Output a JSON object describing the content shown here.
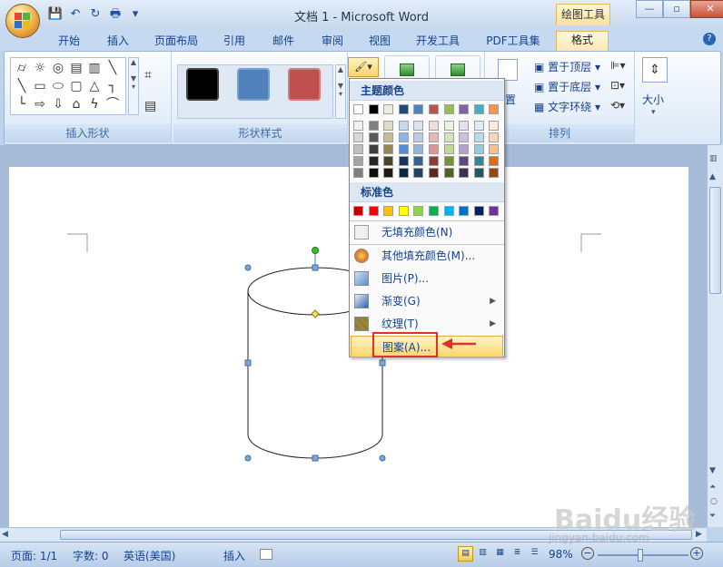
{
  "window": {
    "doc_title": "文档 1 - Microsoft Word",
    "context_tab": "绘图工具",
    "min": "—",
    "max": "▫",
    "close": "✕"
  },
  "qat": {
    "save": "💾",
    "undo": "↶",
    "redo": "↻",
    "print": "🖶",
    "more": "▾"
  },
  "tabs": [
    "开始",
    "插入",
    "页面布局",
    "引用",
    "邮件",
    "审阅",
    "视图",
    "开发工具",
    "PDF工具集",
    "格式"
  ],
  "active_tab": "格式",
  "ribbon": {
    "insert_shapes": {
      "label": "插入形状"
    },
    "shape_styles": {
      "label": "形状样式"
    },
    "arrange": {
      "label": "排列",
      "bring_front": "置于顶层",
      "send_back": "置于底层",
      "text_wrap": "文字环绕",
      "position": "置"
    },
    "size": {
      "label": "大小"
    }
  },
  "style_swatches": [
    "#000000",
    "#4f81bd",
    "#c0504d"
  ],
  "fill_menu": {
    "theme_colors_header": "主题颜色",
    "standard_colors_header": "标准色",
    "theme_top_row": [
      "#ffffff",
      "#000000",
      "#eeece1",
      "#1f497d",
      "#4f81bd",
      "#c0504d",
      "#9bbb59",
      "#8064a2",
      "#4bacc6",
      "#f79646"
    ],
    "theme_tints": [
      [
        "#f2f2f2",
        "#7f7f7f",
        "#ddd9c3",
        "#c6d9f0",
        "#dbe5f1",
        "#f2dcdb",
        "#ebf1dd",
        "#e5e0ec",
        "#dbeef3",
        "#fdeada"
      ],
      [
        "#d8d8d8",
        "#595959",
        "#c4bd97",
        "#8db3e2",
        "#b8cce4",
        "#e5b9b7",
        "#d7e3bc",
        "#ccc1d9",
        "#b7dde8",
        "#fbd5b5"
      ],
      [
        "#bfbfbf",
        "#3f3f3f",
        "#938953",
        "#548dd4",
        "#95b3d7",
        "#d99694",
        "#c3d69b",
        "#b2a2c7",
        "#92cddc",
        "#fac08f"
      ],
      [
        "#a5a5a5",
        "#262626",
        "#494429",
        "#17365d",
        "#366092",
        "#953734",
        "#76923c",
        "#5f497a",
        "#31859b",
        "#e36c09"
      ],
      [
        "#7f7f7f",
        "#0c0c0c",
        "#1d1b10",
        "#0f243e",
        "#244061",
        "#632423",
        "#4f6128",
        "#3f3151",
        "#205867",
        "#974806"
      ]
    ],
    "standard_colors": [
      "#c00000",
      "#ff0000",
      "#ffc000",
      "#ffff00",
      "#92d050",
      "#00b050",
      "#00b0f0",
      "#0070c0",
      "#002060",
      "#7030a0"
    ],
    "items": [
      {
        "label": "无填充颜色(N)"
      },
      {
        "label": "其他填充颜色(M)..."
      },
      {
        "label": "图片(P)..."
      },
      {
        "label": "渐变(G)",
        "submenu": "▶"
      },
      {
        "label": "纹理(T)",
        "submenu": "▶"
      },
      {
        "label": "图案(A)..."
      }
    ]
  },
  "statusbar": {
    "page": "页面: 1/1",
    "words": "字数: 0",
    "language": "英语(美国)",
    "mode": "插入",
    "zoom": "98%"
  },
  "watermark": {
    "brand": "Baidu经验",
    "site": "jingyan.baidu.com"
  }
}
